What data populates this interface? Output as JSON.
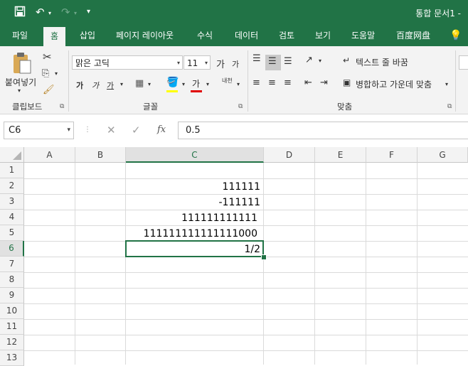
{
  "window": {
    "title": "통합 문서1 - "
  },
  "tabs": [
    "파일",
    "홈",
    "삽입",
    "페이지 레이아웃",
    "수식",
    "데이터",
    "검토",
    "보기",
    "도움말",
    "百度网盘"
  ],
  "active_tab": "홈",
  "ribbon": {
    "clipboard": {
      "paste_label": "붙여넣기",
      "group_label": "클립보드"
    },
    "font": {
      "font_name": "맑은 고딕",
      "font_size": "11",
      "grow": "가",
      "shrink": "가",
      "bold": "가",
      "italic": "가",
      "underline": "가",
      "fontcolor": "가",
      "phonetic": "내천",
      "group_label": "글꼴"
    },
    "alignment": {
      "wrap_text": "텍스트 줄 바꿈",
      "merge_center": "병합하고 가운데 맞춤",
      "group_label": "맞춤"
    }
  },
  "formula_bar": {
    "name_box": "C6",
    "fx": "fx",
    "value": "0.5"
  },
  "columns": [
    "A",
    "B",
    "C",
    "D",
    "E",
    "F",
    "G"
  ],
  "selected_column": "C",
  "rows": [
    "1",
    "2",
    "3",
    "4",
    "5",
    "6",
    "7",
    "8",
    "9",
    "10",
    "11",
    "12",
    "13"
  ],
  "selected_row": "6",
  "cells": {
    "C2": "111111",
    "C3": "-111111",
    "C4": "111111111111",
    "C5": "111111111111111000",
    "C6": "1/2"
  },
  "colors": {
    "accent": "#217346",
    "ribbon_bg": "#f3f3f3"
  }
}
